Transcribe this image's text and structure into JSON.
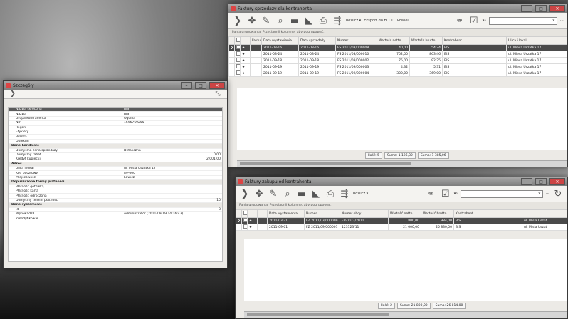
{
  "top_window": {
    "title": "Faktury sprzedaży dla kontrahenta",
    "toolbar": {
      "rozlicz": "Rozlicz ▾",
      "eksport": "Eksport do ECOD",
      "powiel": "Powiel"
    },
    "group_hint": "Pania grupowania. Przeciągnij kolumnę, aby pogrupować.",
    "columns": [
      "",
      "",
      "Faktury",
      "Data wystawienia",
      "Data sprzedaży",
      "Numer",
      "Wartość netto",
      "Wartość brutto",
      "Kontrahent",
      "Ulica i lokal"
    ],
    "rows": [
      {
        "date1": "2011-03-16",
        "date2": "2011-03-16",
        "num": "FS 2011/03/000008",
        "netto": "40,00",
        "brutto": "54,24",
        "kontr": "BIS",
        "ulica": "ul. Miesa Uszatka 17",
        "sel": true
      },
      {
        "date1": "2011-03-24",
        "date2": "2011-03-24",
        "num": "FS 2011/03/000010",
        "netto": "702,00",
        "brutto": "863,46",
        "kontr": "BIS",
        "ulica": "ul. Miesa Uszatka 17",
        "sel": false
      },
      {
        "date1": "2011-09-18",
        "date2": "2011-09-18",
        "num": "FS 2011/09/000002",
        "netto": "75,00",
        "brutto": "92,25",
        "kontr": "BIS",
        "ulica": "ul. Miesa Uszatka 17",
        "sel": false
      },
      {
        "date1": "2011-09-19",
        "date2": "2011-09-19",
        "num": "FS 2011/09/000003",
        "netto": "4,32",
        "brutto": "5,31",
        "kontr": "BIS",
        "ulica": "ul. Miesa Uszatka 17",
        "sel": false
      },
      {
        "date1": "2011-09-19",
        "date2": "2011-09-19",
        "num": "FS 2011/09/000004",
        "netto": "300,00",
        "brutto": "369,00",
        "kontr": "BIS",
        "ulica": "ul. Miesa Uszatka 17",
        "sel": false
      }
    ],
    "footer": {
      "count": "Ilość: 5",
      "sum_netto": "Suma: 1 126,32",
      "sum_brutto": "Suma: 1 385,06"
    }
  },
  "bottom_window": {
    "title": "Faktury zakupu od kontrahenta",
    "toolbar": {
      "rozlicz": "Rozlicz ▾"
    },
    "group_hint": "Pania grupowania. Przeciągnij kolumnę, aby pogrupować.",
    "columns": [
      "",
      "",
      "",
      "Data wystawienia",
      "Numer",
      "Numer obcy",
      "Wartość netto",
      "Wartość brutto",
      "Kontrahent",
      ""
    ],
    "rows": [
      {
        "date": "2011-03-21",
        "num": "FZ 2011/03/000009",
        "obcy": "FV-0023/2011",
        "netto": "800,00",
        "brutto": "984,00",
        "kontr": "BIS",
        "ulica": "ul. Misia Uszat",
        "sel": true
      },
      {
        "date": "2011-09-01",
        "num": "FZ 2011/09/000001",
        "obcy": "123123/11",
        "netto": "21 000,00",
        "brutto": "25 830,00",
        "kontr": "BIS",
        "ulica": "ul. Misia Uszat",
        "sel": false
      }
    ],
    "footer": {
      "count": "Ilość: 2",
      "sum_netto": "Suma: 21 800,00",
      "sum_brutto": "Suma: 26 814,00"
    }
  },
  "details_window": {
    "title": "Szczegóły",
    "rows": [
      {
        "label": "Nazwa skrócona",
        "value": "BIS",
        "rv": "",
        "type": "hl"
      },
      {
        "label": "Nazwa",
        "value": "BIS",
        "rv": "",
        "type": "row"
      },
      {
        "label": "Grupa kontrahenta",
        "value": "Ogólna",
        "rv": "",
        "type": "row"
      },
      {
        "label": "NIP",
        "value": "1696769255",
        "rv": "",
        "type": "row"
      },
      {
        "label": "Regon",
        "value": "",
        "rv": "",
        "type": "row"
      },
      {
        "label": "Etykiety",
        "value": "",
        "rv": "",
        "type": "row"
      },
      {
        "label": "Branża",
        "value": "",
        "rv": "",
        "type": "row"
      },
      {
        "label": "Opiekun",
        "value": "",
        "rv": "",
        "type": "row"
      },
      {
        "label": "Dane handlowe",
        "value": "",
        "rv": "",
        "type": "section"
      },
      {
        "label": "Domyślna cena sprzedaży",
        "value": "Detaliczna",
        "rv": "",
        "type": "row"
      },
      {
        "label": "Domyślny rabat",
        "value": "",
        "rv": "0,00",
        "type": "row"
      },
      {
        "label": "Kredyt kupiecki",
        "value": "",
        "rv": "2 001,00",
        "type": "row"
      },
      {
        "label": "Adres",
        "value": "",
        "rv": "",
        "type": "section"
      },
      {
        "label": "Ulica i lokal",
        "value": "ul. Misia Uszatka 17",
        "rv": "",
        "type": "row"
      },
      {
        "label": "Kod pocztowy",
        "value": "89-600",
        "rv": "",
        "type": "row"
      },
      {
        "label": "Miejscowość",
        "value": "Łowicz",
        "rv": "",
        "type": "row"
      },
      {
        "label": "Dopuszczone formy płatności",
        "value": "",
        "rv": "",
        "type": "section"
      },
      {
        "label": "Płatność gotówką",
        "value": "",
        "rv": "",
        "type": "row"
      },
      {
        "label": "Płatność kartą",
        "value": "",
        "rv": "",
        "type": "row"
      },
      {
        "label": "Płatność odroczona",
        "value": "",
        "rv": "",
        "type": "row"
      },
      {
        "label": "Domyślny termin płatności",
        "value": "",
        "rv": "10",
        "type": "row"
      },
      {
        "label": "Dane systemowe",
        "value": "",
        "rv": "",
        "type": "section"
      },
      {
        "label": "Id",
        "value": "",
        "rv": "3",
        "type": "row"
      },
      {
        "label": "Wprowadził",
        "value": "Administrator (2011-09-19 14:16:43)",
        "rv": "",
        "type": "row"
      },
      {
        "label": "Zmodyfikował",
        "value": "",
        "rv": "",
        "type": "row"
      }
    ]
  }
}
